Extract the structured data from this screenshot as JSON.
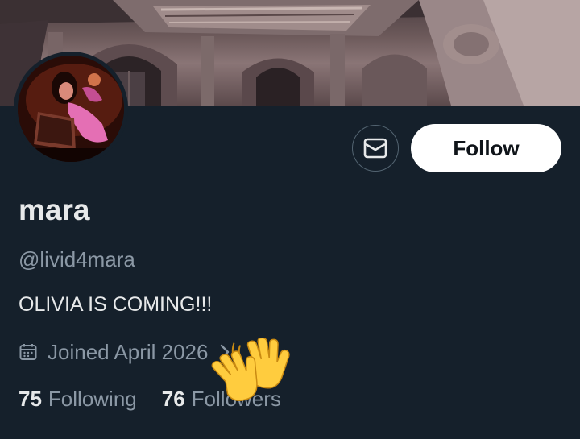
{
  "profile": {
    "display_name": "mara",
    "handle": "@livid4mara",
    "bio": "OLIVIA IS COMING!!!",
    "joined": "Joined April 2026",
    "following_count": "75",
    "following_label": "Following",
    "followers_count": "76",
    "followers_label": "Followers"
  },
  "actions": {
    "follow_label": "Follow",
    "message_icon": "mail-icon"
  },
  "colors": {
    "background": "#15202b",
    "primary_text": "#e7e9ea",
    "secondary_text": "#8b98a5",
    "button_bg": "#ffffff",
    "button_text": "#0f1419"
  },
  "overlay": {
    "emoji": "waving-hands-emoji"
  }
}
